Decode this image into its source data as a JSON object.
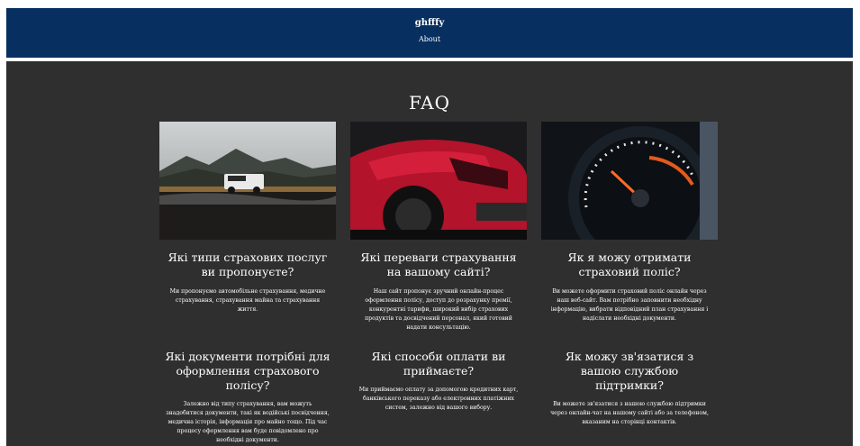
{
  "header": {
    "brand": "ghfffy",
    "nav_about": "About"
  },
  "main": {
    "title": "FAQ",
    "cards": [
      {
        "question": "Які типи страхових послуг ви пропонуєте?",
        "answer": "Ми пропонуємо автомобільне страхування, медичне страхування, страхування майна та страхування життя."
      },
      {
        "question": "Які переваги страхування на вашому сайті?",
        "answer": "Наш сайт пропонує зручний онлайн-процес оформлення полісу, доступ до розрахунку премії, конкурентні тарифи, широкий вибір страхових продуктів та досвідчений персонал, який готовий надати консультацію."
      },
      {
        "question": "Як я можу отримати страховий поліс?",
        "answer": "Ви можете оформити страховий поліс онлайн через наш веб-сайт. Вам потрібно заповнити необхідну інформацію, вибрати відповідний план страхування і надіслати необхідні документи."
      },
      {
        "question": "Які документи потрібні для оформлення страхового полісу?",
        "answer": "Залежно від типу страхування, вам можуть знадобитися документи, такі як водійські посвідчення, медична історія, інформація про майно тощо. Під час процесу оформлення вам буде повідомлено про необхідні документи."
      },
      {
        "question": "Які способи оплати ви приймаєте?",
        "answer": "Ми приймаємо оплату за допомогою кредитних карт, банківського переказу або електронних платіжних систем, залежно від вашого вибору."
      },
      {
        "question": "Як можу зв'язатися з вашою службою підтримки?",
        "answer": "Ви можете зв'язатися з нашою службою підтримки через онлайн-чат на нашому сайті або за телефоном, вказаним на сторінці контактів."
      }
    ]
  }
}
